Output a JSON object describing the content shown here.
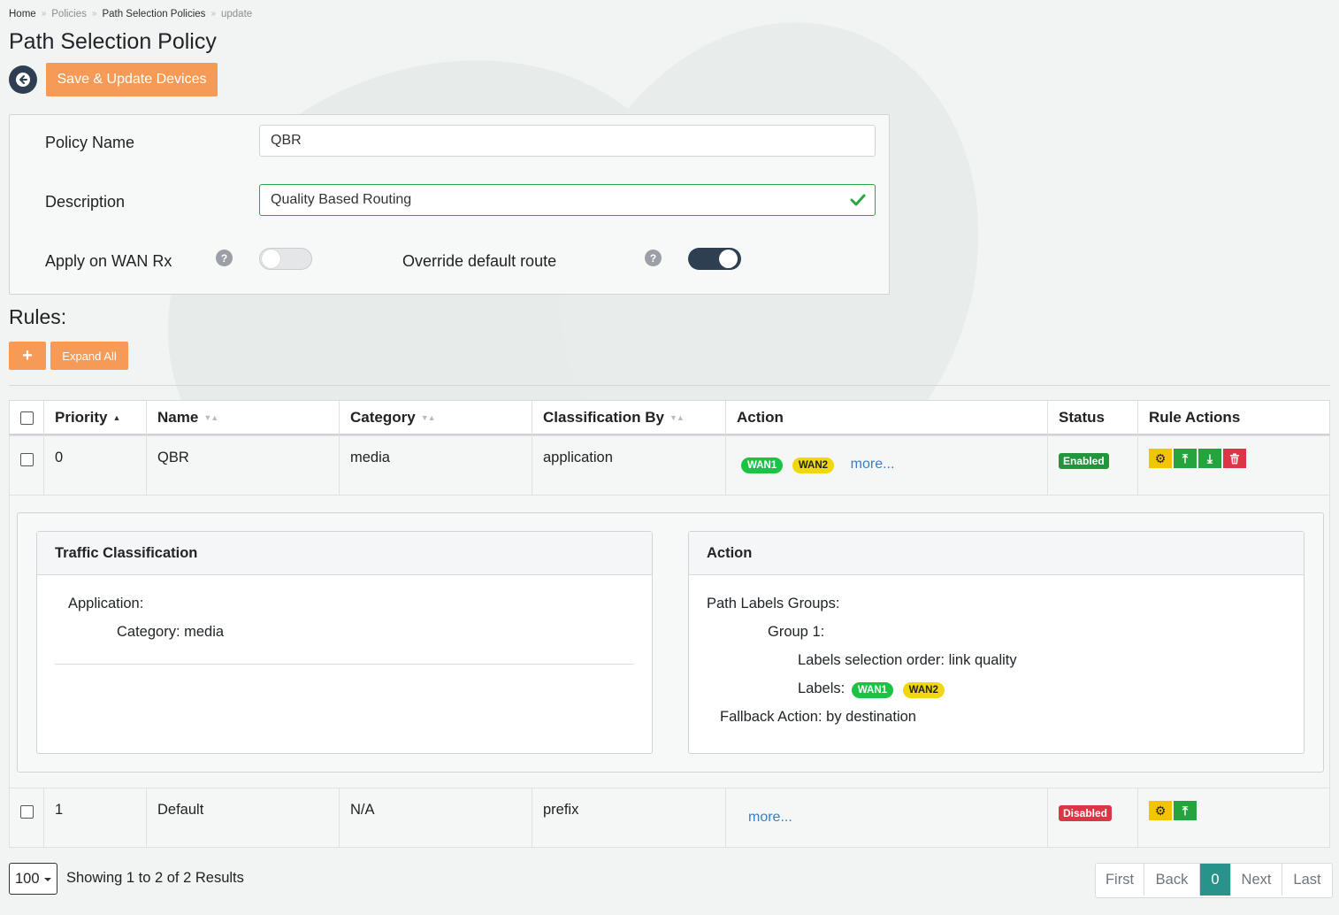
{
  "breadcrumb": [
    "Home",
    "Policies",
    "Path Selection Policies",
    "update"
  ],
  "breadcrumb_sep": "»",
  "page_title": "Path Selection Policy",
  "toolbar": {
    "back_icon": "arrow-left-circle-icon",
    "save_label": "Save & Update Devices"
  },
  "form": {
    "policy_name_label": "Policy Name",
    "policy_name_value": "QBR",
    "description_label": "Description",
    "description_value": "Quality Based Routing",
    "apply_wan_rx_label": "Apply on WAN Rx",
    "apply_wan_rx_on": false,
    "override_label": "Override default route",
    "override_on": true,
    "help_glyph": "?"
  },
  "rules": {
    "title": "Rules:",
    "add_label": "+",
    "expand_all_label": "Expand All",
    "columns": [
      "Priority",
      "Name",
      "Category",
      "Classification By",
      "Action",
      "Status",
      "Rule Actions"
    ],
    "rows": [
      {
        "priority": "0",
        "name": "QBR",
        "category": "media",
        "classification": "application",
        "labels": [
          "WAN1",
          "WAN2"
        ],
        "more": "more...",
        "status": "Enabled",
        "actions": [
          "settings-icon",
          "move-up-icon",
          "move-down-icon",
          "delete-icon"
        ]
      },
      {
        "priority": "1",
        "name": "Default",
        "category": "N/A",
        "classification": "prefix",
        "labels": [],
        "more": "more...",
        "status": "Disabled",
        "actions": [
          "settings-icon",
          "move-up-icon"
        ]
      }
    ]
  },
  "detail": {
    "traffic_title": "Traffic Classification",
    "application_label": "Application:",
    "category_line": "Category: media",
    "action_title": "Action",
    "path_groups_label": "Path Labels Groups:",
    "group_label": "Group 1:",
    "selection_order": "Labels selection order: link quality",
    "labels_label": "Labels:",
    "labels": [
      "WAN1",
      "WAN2"
    ],
    "fallback": "Fallback Action: by destination"
  },
  "footer": {
    "page_size": "100",
    "showing": "Showing 1 to 2 of 2 Results",
    "pager": [
      "First",
      "Back",
      "0",
      "Next",
      "Last"
    ]
  },
  "colors": {
    "accent": "#f59a57",
    "dark": "#2f3f52",
    "teal": "#27938a",
    "green": "#1cc244",
    "yellow": "#f0d70f",
    "red": "#dc3545"
  }
}
